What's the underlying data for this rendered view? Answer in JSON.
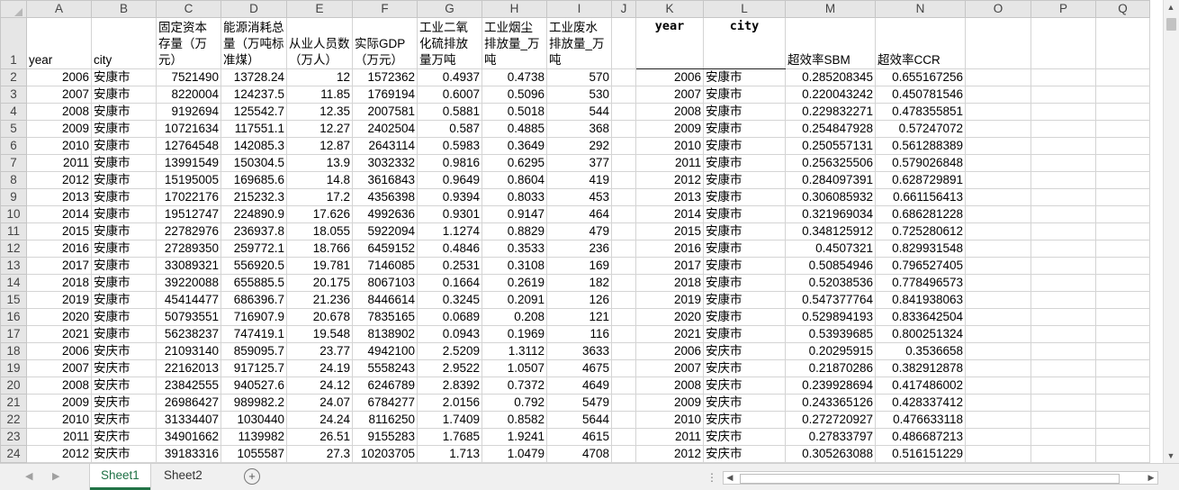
{
  "columns": [
    "A",
    "B",
    "C",
    "D",
    "E",
    "F",
    "G",
    "H",
    "I",
    "J",
    "K",
    "L",
    "M",
    "N",
    "O",
    "P",
    "Q"
  ],
  "header_row": {
    "row_num": "1",
    "cells": [
      "year",
      "city",
      "固定资本存量（万元）",
      "能源消耗总量（万吨标准煤）",
      "从业人员数（万人）",
      "实际GDP（万元）",
      "工业二氧化硫排放量万吨",
      "工业烟尘排放量_万吨",
      "工业废水排放量_万吨",
      "",
      "year",
      "city",
      "超效率SBM",
      "超效率CCR",
      "",
      "",
      ""
    ]
  },
  "rows": [
    {
      "n": "2",
      "c": [
        "2006",
        "安康市",
        "7521490",
        "13728.24",
        "12",
        "1572362",
        "0.4937",
        "0.4738",
        "570",
        "",
        "2006",
        "安康市",
        "0.285208345",
        "0.655167256"
      ]
    },
    {
      "n": "3",
      "c": [
        "2007",
        "安康市",
        "8220004",
        "124237.5",
        "11.85",
        "1769194",
        "0.6007",
        "0.5096",
        "530",
        "",
        "2007",
        "安康市",
        "0.220043242",
        "0.450781546"
      ]
    },
    {
      "n": "4",
      "c": [
        "2008",
        "安康市",
        "9192694",
        "125542.7",
        "12.35",
        "2007581",
        "0.5881",
        "0.5018",
        "544",
        "",
        "2008",
        "安康市",
        "0.229832271",
        "0.478355851"
      ]
    },
    {
      "n": "5",
      "c": [
        "2009",
        "安康市",
        "10721634",
        "117551.1",
        "12.27",
        "2402504",
        "0.587",
        "0.4885",
        "368",
        "",
        "2009",
        "安康市",
        "0.254847928",
        "0.57247072"
      ]
    },
    {
      "n": "6",
      "c": [
        "2010",
        "安康市",
        "12764548",
        "142085.3",
        "12.87",
        "2643114",
        "0.5983",
        "0.3649",
        "292",
        "",
        "2010",
        "安康市",
        "0.250557131",
        "0.561288389"
      ]
    },
    {
      "n": "7",
      "c": [
        "2011",
        "安康市",
        "13991549",
        "150304.5",
        "13.9",
        "3032332",
        "0.9816",
        "0.6295",
        "377",
        "",
        "2011",
        "安康市",
        "0.256325506",
        "0.579026848"
      ]
    },
    {
      "n": "8",
      "c": [
        "2012",
        "安康市",
        "15195005",
        "169685.6",
        "14.8",
        "3616843",
        "0.9649",
        "0.8604",
        "419",
        "",
        "2012",
        "安康市",
        "0.284097391",
        "0.628729891"
      ]
    },
    {
      "n": "9",
      "c": [
        "2013",
        "安康市",
        "17022176",
        "215232.3",
        "17.2",
        "4356398",
        "0.9394",
        "0.8033",
        "453",
        "",
        "2013",
        "安康市",
        "0.306085932",
        "0.661156413"
      ]
    },
    {
      "n": "10",
      "c": [
        "2014",
        "安康市",
        "19512747",
        "224890.9",
        "17.626",
        "4992636",
        "0.9301",
        "0.9147",
        "464",
        "",
        "2014",
        "安康市",
        "0.321969034",
        "0.686281228"
      ]
    },
    {
      "n": "11",
      "c": [
        "2015",
        "安康市",
        "22782976",
        "236937.8",
        "18.055",
        "5922094",
        "1.1274",
        "0.8829",
        "479",
        "",
        "2015",
        "安康市",
        "0.348125912",
        "0.725280612"
      ]
    },
    {
      "n": "12",
      "c": [
        "2016",
        "安康市",
        "27289350",
        "259772.1",
        "18.766",
        "6459152",
        "0.4846",
        "0.3533",
        "236",
        "",
        "2016",
        "安康市",
        "0.4507321",
        "0.829931548"
      ]
    },
    {
      "n": "13",
      "c": [
        "2017",
        "安康市",
        "33089321",
        "556920.5",
        "19.781",
        "7146085",
        "0.2531",
        "0.3108",
        "169",
        "",
        "2017",
        "安康市",
        "0.50854946",
        "0.796527405"
      ]
    },
    {
      "n": "14",
      "c": [
        "2018",
        "安康市",
        "39220088",
        "655885.5",
        "20.175",
        "8067103",
        "0.1664",
        "0.2619",
        "182",
        "",
        "2018",
        "安康市",
        "0.52038536",
        "0.778496573"
      ]
    },
    {
      "n": "15",
      "c": [
        "2019",
        "安康市",
        "45414477",
        "686396.7",
        "21.236",
        "8446614",
        "0.3245",
        "0.2091",
        "126",
        "",
        "2019",
        "安康市",
        "0.547377764",
        "0.841938063"
      ]
    },
    {
      "n": "16",
      "c": [
        "2020",
        "安康市",
        "50793551",
        "716907.9",
        "20.678",
        "7835165",
        "0.0689",
        "0.208",
        "121",
        "",
        "2020",
        "安康市",
        "0.529894193",
        "0.833642504"
      ]
    },
    {
      "n": "17",
      "c": [
        "2021",
        "安康市",
        "56238237",
        "747419.1",
        "19.548",
        "8138902",
        "0.0943",
        "0.1969",
        "116",
        "",
        "2021",
        "安康市",
        "0.53939685",
        "0.800251324"
      ]
    },
    {
      "n": "18",
      "c": [
        "2006",
        "安庆市",
        "21093140",
        "859095.7",
        "23.77",
        "4942100",
        "2.5209",
        "1.3112",
        "3633",
        "",
        "2006",
        "安庆市",
        "0.20295915",
        "0.3536658"
      ]
    },
    {
      "n": "19",
      "c": [
        "2007",
        "安庆市",
        "22162013",
        "917125.7",
        "24.19",
        "5558243",
        "2.9522",
        "1.0507",
        "4675",
        "",
        "2007",
        "安庆市",
        "0.21870286",
        "0.382912878"
      ]
    },
    {
      "n": "20",
      "c": [
        "2008",
        "安庆市",
        "23842555",
        "940527.6",
        "24.12",
        "6246789",
        "2.8392",
        "0.7372",
        "4649",
        "",
        "2008",
        "安庆市",
        "0.239928694",
        "0.417486002"
      ]
    },
    {
      "n": "21",
      "c": [
        "2009",
        "安庆市",
        "26986427",
        "989982.2",
        "24.07",
        "6784277",
        "2.0156",
        "0.792",
        "5479",
        "",
        "2009",
        "安庆市",
        "0.243365126",
        "0.428337412"
      ]
    },
    {
      "n": "22",
      "c": [
        "2010",
        "安庆市",
        "31334407",
        "1030440",
        "24.24",
        "8116250",
        "1.7409",
        "0.8582",
        "5644",
        "",
        "2010",
        "安庆市",
        "0.272720927",
        "0.476633118"
      ]
    },
    {
      "n": "23",
      "c": [
        "2011",
        "安庆市",
        "34901662",
        "1139982",
        "26.51",
        "9155283",
        "1.7685",
        "1.9241",
        "4615",
        "",
        "2011",
        "安庆市",
        "0.27833797",
        "0.486687213"
      ]
    },
    {
      "n": "24",
      "c": [
        "2012",
        "安庆市",
        "39183316",
        "1055587",
        "27.3",
        "10203705",
        "1.713",
        "1.0479",
        "4708",
        "",
        "2012",
        "安庆市",
        "0.305263088",
        "0.516151229"
      ]
    }
  ],
  "sheets": [
    {
      "label": "Sheet1",
      "active": true
    },
    {
      "label": "Sheet2",
      "active": false
    }
  ],
  "add_sheet_glyph": "+",
  "split_glyph": "⋮"
}
